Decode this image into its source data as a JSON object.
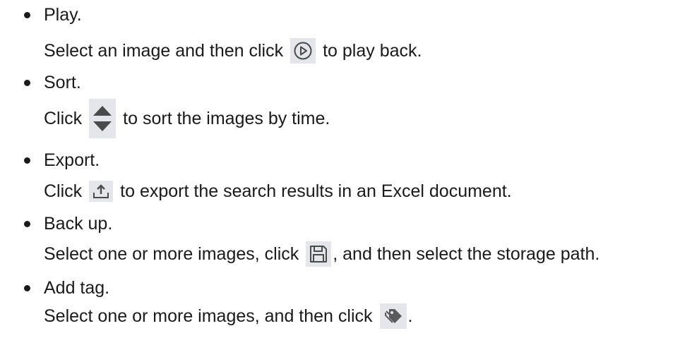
{
  "items": [
    {
      "title": "Play.",
      "desc_before": "Select an image and then click",
      "icon": "play-circle-icon",
      "desc_after": "to play back."
    },
    {
      "title": "Sort.",
      "desc_before": "Click",
      "icon": "sort-arrows-icon",
      "desc_after": "to sort the images by time."
    },
    {
      "title": "Export.",
      "desc_before": "Click",
      "icon": "export-upload-icon",
      "desc_after": "to export the search results in an Excel document."
    },
    {
      "title": "Back up.",
      "desc_before": "Select one or more images, click",
      "icon": "save-disk-icon",
      "desc_after": ", and then select the storage path."
    },
    {
      "title": "Add tag.",
      "desc_before": "Select one or more images, and then click",
      "icon": "tag-icon",
      "desc_after": "."
    }
  ],
  "colors": {
    "text": "#1a1a1a",
    "icon_background": "#e4e6eb",
    "icon_glyph": "#4a4a4a"
  }
}
